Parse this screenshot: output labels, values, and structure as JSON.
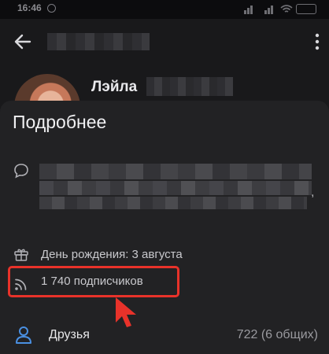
{
  "status_bar": {
    "time": "16:46"
  },
  "profile": {
    "name": "Лэйла"
  },
  "sheet": {
    "title": "Подробнее",
    "about_tail": ",",
    "birthday": "День рождения: 3 августа",
    "followers": "1 740 подписчиков",
    "friends_label": "Друзья",
    "friends_count": "722 (6 общих)"
  },
  "colors": {
    "highlight": "#e8322a",
    "accent": "#4a90e2",
    "sheet_bg": "#222224"
  },
  "icons": {
    "back": "arrow-left-icon",
    "menu": "more-vertical-icon",
    "about": "comment-icon",
    "birthday": "gift-icon",
    "followers": "rss-icon",
    "friends": "user-icon",
    "annotation": "arrow-cursor-icon"
  }
}
